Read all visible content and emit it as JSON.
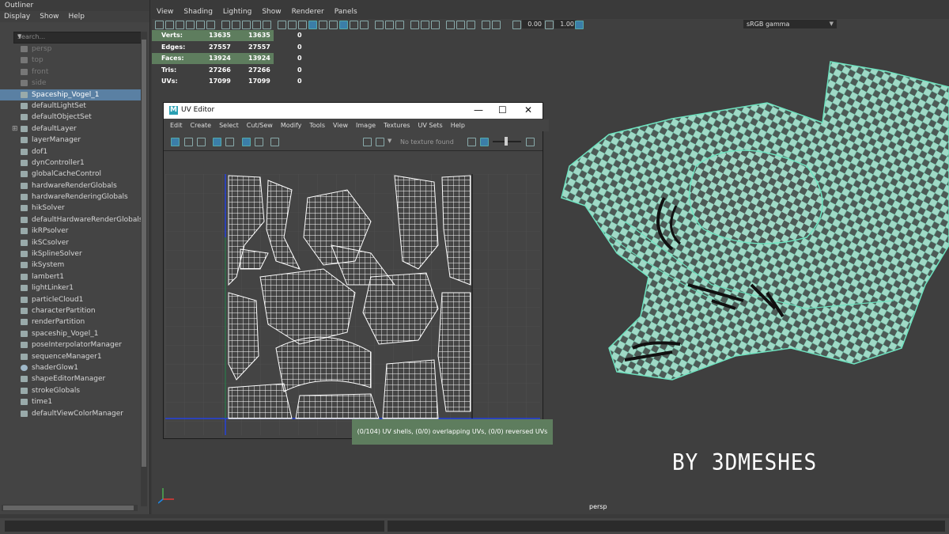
{
  "outliner": {
    "title": "Outliner",
    "menu": [
      "Display",
      "Show",
      "Help"
    ],
    "search_placeholder": "Search...",
    "items": [
      {
        "label": "persp",
        "dim": true,
        "icon": "camera-icon"
      },
      {
        "label": "top",
        "dim": true,
        "icon": "camera-icon"
      },
      {
        "label": "front",
        "dim": true,
        "icon": "camera-icon"
      },
      {
        "label": "side",
        "dim": true,
        "icon": "camera-icon"
      },
      {
        "label": "Spaceship_Vogel_1",
        "selected": true,
        "icon": "transform-icon"
      },
      {
        "label": "defaultLightSet",
        "icon": "set-icon"
      },
      {
        "label": "defaultObjectSet",
        "icon": "set-icon"
      },
      {
        "label": "defaultLayer",
        "icon": "layer-icon",
        "expandable": true
      },
      {
        "label": "layerManager",
        "icon": "node-icon"
      },
      {
        "label": "dof1",
        "icon": "node-icon"
      },
      {
        "label": "dynController1",
        "icon": "node-icon"
      },
      {
        "label": "globalCacheControl",
        "icon": "node-icon"
      },
      {
        "label": "hardwareRenderGlobals",
        "icon": "node-icon"
      },
      {
        "label": "hardwareRenderingGlobals",
        "icon": "node-icon"
      },
      {
        "label": "hikSolver",
        "icon": "node-icon"
      },
      {
        "label": "defaultHardwareRenderGlobals",
        "icon": "node-icon"
      },
      {
        "label": "ikRPsolver",
        "icon": "ik-icon"
      },
      {
        "label": "ikSCsolver",
        "icon": "ik-icon"
      },
      {
        "label": "ikSplineSolver",
        "icon": "ik-icon"
      },
      {
        "label": "ikSystem",
        "icon": "node-icon"
      },
      {
        "label": "lambert1",
        "icon": "material-icon"
      },
      {
        "label": "lightLinker1",
        "icon": "node-icon"
      },
      {
        "label": "particleCloud1",
        "icon": "material-icon"
      },
      {
        "label": "characterPartition",
        "icon": "partition-icon"
      },
      {
        "label": "renderPartition",
        "icon": "partition-icon"
      },
      {
        "label": "spaceship_Vogel_1",
        "icon": "material-icon"
      },
      {
        "label": "poseInterpolatorManager",
        "icon": "node-icon"
      },
      {
        "label": "sequenceManager1",
        "icon": "node-icon"
      },
      {
        "label": "shaderGlow1",
        "icon": "sphere-icon"
      },
      {
        "label": "shapeEditorManager",
        "icon": "node-icon"
      },
      {
        "label": "strokeGlobals",
        "icon": "node-icon"
      },
      {
        "label": "time1",
        "icon": "clock-icon"
      },
      {
        "label": "defaultViewColorManager",
        "icon": "node-icon"
      }
    ]
  },
  "viewport": {
    "menu": [
      "View",
      "Shading",
      "Lighting",
      "Show",
      "Renderer",
      "Panels"
    ],
    "exposure": "0.00",
    "gamma_value": "1.00",
    "color_space": "sRGB gamma",
    "camera_label": "persp",
    "hud": [
      {
        "label": "Verts:",
        "a": "13635",
        "b": "13635",
        "c": "0",
        "highlight": true
      },
      {
        "label": "Edges:",
        "a": "27557",
        "b": "27557",
        "c": "0",
        "highlight": false
      },
      {
        "label": "Faces:",
        "a": "13924",
        "b": "13924",
        "c": "0",
        "highlight": true
      },
      {
        "label": "Tris:",
        "a": "27266",
        "b": "27266",
        "c": "0",
        "highlight": false
      },
      {
        "label": "UVs:",
        "a": "17099",
        "b": "17099",
        "c": "0",
        "highlight": false
      }
    ],
    "byline": "BY 3DMESHES"
  },
  "uv_editor": {
    "title": "UV Editor",
    "window_controls": [
      "—",
      "☐",
      "✕"
    ],
    "menu": [
      "Edit",
      "Create",
      "Select",
      "Cut/Sew",
      "Modify",
      "Tools",
      "View",
      "Image",
      "Textures",
      "UV Sets",
      "Help"
    ],
    "no_texture": "No texture found",
    "status": "(0/104) UV shells, (0/0) overlapping UVs, (0/0) reversed UVs"
  },
  "colors": {
    "selection": "#5a80a3",
    "hud_highlight": "#5e7d5e",
    "mesh_wire": "#6fe3c0",
    "uv_wire": "#ffffff"
  }
}
